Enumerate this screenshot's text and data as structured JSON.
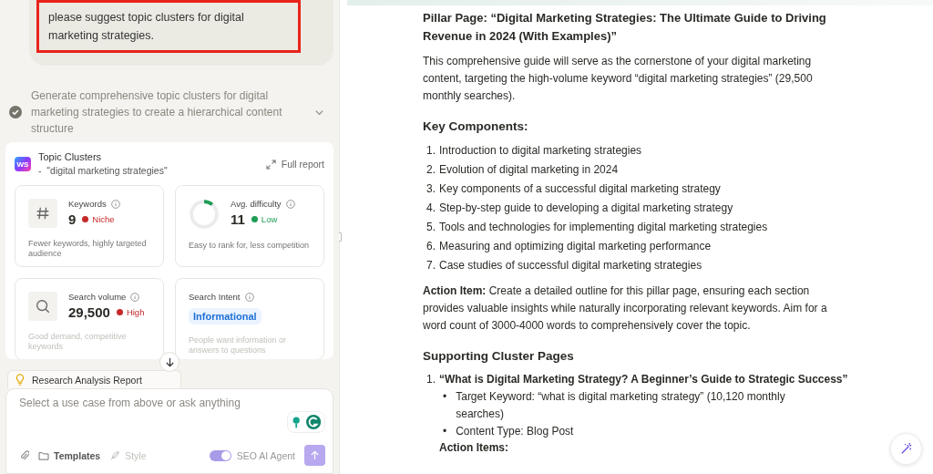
{
  "chat": {
    "user_message": {
      "text": "please suggest topic clusters for digital marketing strategies.",
      "highlighted": true
    },
    "step": {
      "text": "Generate comprehensive topic clusters for digital marketing strategies to create a hierarchical content structure",
      "done": true,
      "expanded": false
    },
    "card": {
      "logo": "WS",
      "title": "Topic Clusters",
      "subtitle": "-  \"digital marketing strategies\"",
      "full_report": "Full report",
      "tiles": [
        {
          "kind": "icon",
          "label": "Keywords",
          "value": "9",
          "tag": "Niche",
          "color": "#c62828",
          "note": "Fewer keywords, highly targeted audience"
        },
        {
          "kind": "donut",
          "label": "Avg. difficulty",
          "value": "11",
          "tag": "Low",
          "color": "#1f9d55",
          "level": 0.11,
          "note": "Easy to rank for, less competition"
        },
        {
          "kind": "icon",
          "label": "Search volume",
          "value": "29,500",
          "tag": "High",
          "color": "#c62828",
          "note": "Good demand, competitive keywords"
        },
        {
          "kind": "intent",
          "label": "Search Intent",
          "badge": "Informational",
          "note": "People want information or answers to questions"
        }
      ]
    },
    "report_tab": "Research Analysis Report",
    "input": {
      "placeholder": "Select a use case from above or ask anything",
      "templates": "Templates",
      "style": {
        "label": "Style",
        "disabled": true
      },
      "agent": {
        "label": "SEO AI Agent",
        "on": true
      }
    }
  },
  "document": {
    "title": "Pillar Page: “Digital Marketing Strategies: The Ultimate Guide to Driving Revenue in 2024 (With Examples)”",
    "intro": "This comprehensive guide will serve as the cornerstone of your digital marketing content, targeting the high-volume keyword “digital marketing strategies” (29,500 monthly searches).",
    "components_heading": "Key Components:",
    "components": [
      {
        "marker": "1.",
        "text": "Introduction to digital marketing strategies"
      },
      {
        "marker": "2.",
        "text": "Evolution of digital marketing in 2024"
      },
      {
        "marker": "3.",
        "text": "Key components of a successful digital marketing strategy"
      },
      {
        "marker": "4.",
        "text": "Step-by-step guide to developing a digital marketing strategy"
      },
      {
        "marker": "5.",
        "text": "Tools and technologies for implementing digital marketing strategies"
      },
      {
        "marker": "6.",
        "text": "Measuring and optimizing digital marketing performance"
      },
      {
        "marker": "7.",
        "text": "Case studies of successful digital marketing strategies"
      }
    ],
    "action_item": "**Action Item:** Create a detailed outline for this pillar page, ensuring each section provides valuable insights while naturally incorporating relevant keywords. Aim for a word count of 3000-4000 words to comprehensively cover the topic.",
    "cluster_heading": "Supporting Cluster Pages",
    "clusters": [
      {
        "marker": "1.",
        "title": "“What is Digital Marketing Strategy? A Beginner’s Guide to Strategic Success”",
        "bullets": [
          {
            "marker": "•",
            "text": "Target Keyword: “what is digital marketing strategy” (10,120 monthly searches)"
          },
          {
            "marker": "•",
            "text": "Content Type: Blog Post"
          }
        ],
        "sub_heading": "Action Items:"
      }
    ]
  }
}
